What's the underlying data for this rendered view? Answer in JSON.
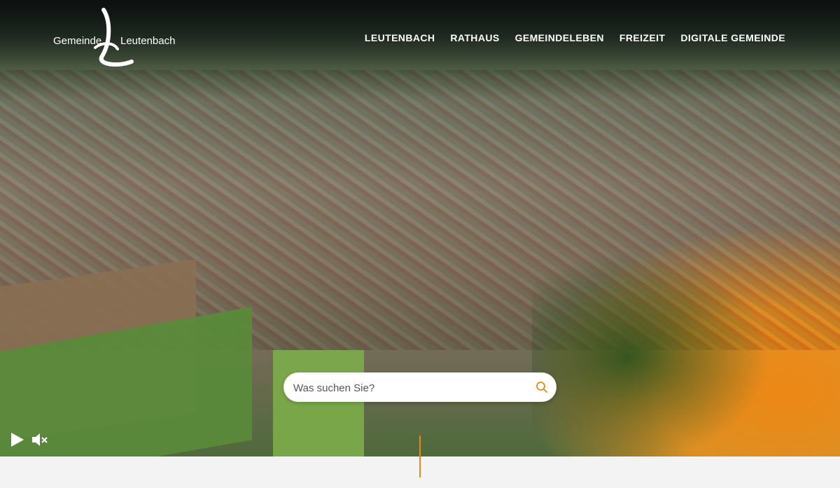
{
  "header": {
    "logo_text_left": "Gemeinde",
    "logo_text_right": "Leutenbach"
  },
  "nav": {
    "items": [
      {
        "label": "LEUTENBACH"
      },
      {
        "label": "RATHAUS"
      },
      {
        "label": "GEMEINDELEBEN"
      },
      {
        "label": "FREIZEIT"
      },
      {
        "label": "DIGITALE GEMEINDE"
      }
    ]
  },
  "search": {
    "placeholder": "Was suchen Sie?",
    "icon": "search-icon"
  },
  "video_controls": {
    "play_icon": "play-icon",
    "mute_icon": "mute-icon"
  },
  "colors": {
    "accent": "#e58a14",
    "text_on_hero": "#ffffff",
    "footer_strip": "#f3f3f3"
  }
}
